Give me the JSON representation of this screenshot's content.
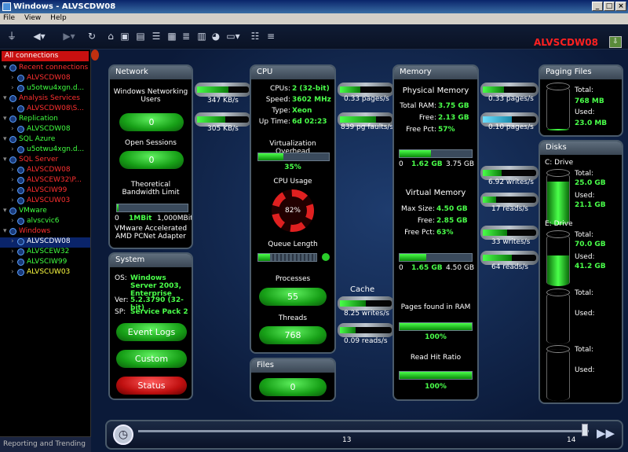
{
  "window": {
    "title": "Windows - ALVSCDW08",
    "min": "_",
    "max": "□",
    "close": "×"
  },
  "menu": [
    "File",
    "View",
    "Help"
  ],
  "header": {
    "hostname": "ALVSCDW08"
  },
  "sidebar": {
    "header": "All connections",
    "footer": "Reporting and Trending",
    "items": [
      {
        "label": "Recent connections",
        "color": "#ff3030",
        "level": 0
      },
      {
        "label": "ALVSCDW08",
        "color": "#ff3030",
        "level": 1
      },
      {
        "label": "u5otwu4xgn.d...",
        "color": "#40ff40",
        "level": 1
      },
      {
        "label": "Analysis Services",
        "color": "#ff3030",
        "level": 0
      },
      {
        "label": "ALVSCDW08\\S...",
        "color": "#ff3030",
        "level": 1
      },
      {
        "label": "Replication",
        "color": "#40ff40",
        "level": 0
      },
      {
        "label": "ALVSCDW08",
        "color": "#40ff40",
        "level": 1
      },
      {
        "label": "SQL Azure",
        "color": "#40ff40",
        "level": 0
      },
      {
        "label": "u5otwu4xgn.d...",
        "color": "#40ff40",
        "level": 1
      },
      {
        "label": "SQL Server",
        "color": "#ff3030",
        "level": 0
      },
      {
        "label": "ALVSCDW08",
        "color": "#ff3030",
        "level": 1
      },
      {
        "label": "ALVSCEW32\\P...",
        "color": "#ff3030",
        "level": 1
      },
      {
        "label": "ALVSCIW99",
        "color": "#ff3030",
        "level": 1
      },
      {
        "label": "ALVSCUW03",
        "color": "#ff3030",
        "level": 1
      },
      {
        "label": "VMware",
        "color": "#40ff40",
        "level": 0
      },
      {
        "label": "alvscvic6",
        "color": "#40ff40",
        "level": 1
      },
      {
        "label": "Windows",
        "color": "#ff3030",
        "level": 0
      },
      {
        "label": "ALVSCDW08",
        "color": "#ffffff",
        "level": 1,
        "selected": true
      },
      {
        "label": "ALVSCEW32",
        "color": "#40ff40",
        "level": 1
      },
      {
        "label": "ALVSCIW99",
        "color": "#40ff40",
        "level": 1
      },
      {
        "label": "ALVSCUW03",
        "color": "#ffff40",
        "level": 1
      }
    ]
  },
  "network": {
    "title": "Network",
    "users_label": "Windows Networking Users",
    "users_value": "0",
    "sessions_label": "Open Sessions",
    "sessions_value": "0",
    "bandwidth_label": "Theoretical Bandwidth Limit",
    "bw_min": "0",
    "bw_value": "1MBit",
    "bw_max": "1,000MBit",
    "adapter": "VMware Accelerated AMD PCNet Adapter",
    "rate1": "347 KB/s",
    "rate2": "305 KB/s"
  },
  "system": {
    "title": "System",
    "os_label": "OS:",
    "os_value": "Windows Server 2003, Enterprise",
    "ver_label": "Ver:",
    "ver_value": "5.2.3790 (32-bit)",
    "sp_label": "SP:",
    "sp_value": "Service Pack 2",
    "btn_event": "Event Logs",
    "btn_custom": "Custom",
    "btn_status": "Status"
  },
  "cpu": {
    "title": "CPU",
    "cpus_label": "CPUs:",
    "cpus_value": "2 (32-bit)",
    "speed_label": "Speed:",
    "speed_value": "3602 MHz",
    "type_label": "Type:",
    "type_value": "Xeon",
    "uptime_label": "Up Time:",
    "uptime_value": "6d 02:23",
    "virt_label": "Virtualization Overhead",
    "virt_value": "35%",
    "virt_fraction": 0.35,
    "usage_label": "CPU Usage",
    "usage_value": "82%",
    "queue_label": "Queue Length",
    "processes_label": "Processes",
    "processes_value": "55",
    "threads_label": "Threads",
    "threads_value": "768"
  },
  "files": {
    "title": "Files",
    "value": "0"
  },
  "pipes_mid": {
    "pages_in": "0.33 pages/s",
    "faults": "839 pg faults/s",
    "cache_label": "Cache",
    "cache_writes": "8.25 writes/s",
    "cache_reads": "0.09 reads/s"
  },
  "memory": {
    "title": "Memory",
    "phys_title": "Physical Memory",
    "total_label": "Total RAM:",
    "total_value": "3.75 GB",
    "free_label": "Free:",
    "free_value": "2.13 GB",
    "freepct_label": "Free Pct:",
    "freepct_value": "57%",
    "phys_bar_min": "0",
    "phys_bar_used": "1.62 GB",
    "phys_bar_max": "3.75 GB",
    "phys_fraction": 0.43,
    "virt_title": "Virtual Memory",
    "maxsize_label": "Max Size:",
    "maxsize_value": "4.50 GB",
    "vfree_label": "Free:",
    "vfree_value": "2.85 GB",
    "vfreepct_label": "Free Pct:",
    "vfreepct_value": "63%",
    "virt_bar_min": "0",
    "virt_bar_used": "1.65 GB",
    "virt_bar_max": "4.50 GB",
    "virt_fraction": 0.37,
    "pages_ram_label": "Pages found in RAM",
    "pages_ram_value": "100%",
    "hit_label": "Read Hit Ratio",
    "hit_value": "100%"
  },
  "pipes_right": {
    "page_out": "0.33 pages/s",
    "page_in": "0.10 pages/s",
    "c_writes": "6.92 writes/s",
    "c_reads": "17 reads/s",
    "e_writes": "33 writes/s",
    "e_reads": "64 reads/s"
  },
  "paging": {
    "title": "Paging Files",
    "total_label": "Total:",
    "total_value": "768 MB",
    "used_label": "Used:",
    "used_value": "23.0 MB",
    "fraction": 0.03
  },
  "disks": {
    "title": "Disks",
    "c_label": "C: Drive",
    "c_total_label": "Total:",
    "c_total": "25.0 GB",
    "c_used_label": "Used:",
    "c_used": "21.1 GB",
    "c_fraction": 0.84,
    "e_label": "E: Drive",
    "e_total_label": "Total:",
    "e_total": "70.0 GB",
    "e_used_label": "Used:",
    "e_used": "41.2 GB",
    "e_fraction": 0.59,
    "d3_total_label": "Total:",
    "d3_used_label": "Used:",
    "d4_total_label": "Total:",
    "d4_used_label": "Used:"
  },
  "timeline": {
    "tick1": "13",
    "tick2": "14"
  }
}
